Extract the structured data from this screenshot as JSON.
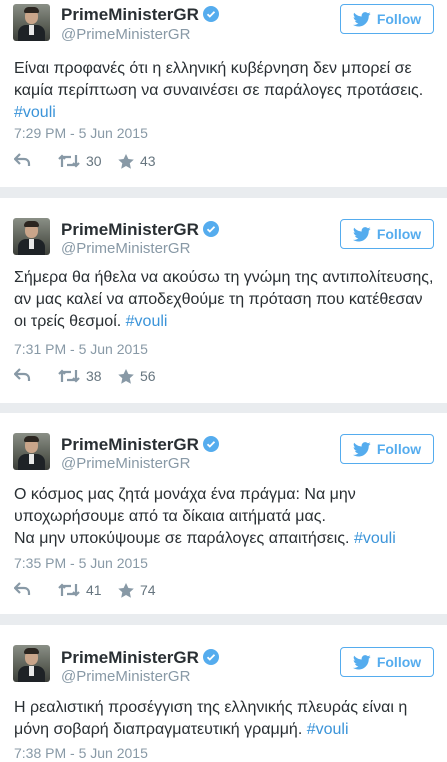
{
  "follow_label": "Follow",
  "colors": {
    "accent": "#55acee",
    "link": "#3b94d9",
    "muted": "#8899a6",
    "text": "#292f33"
  },
  "tweets": [
    {
      "name": "PrimeMinisterGR",
      "handle": "@PrimeMinisterGR",
      "text": "Είναι προφανές ότι η ελληνική κυβέρνηση δεν μπορεί σε καμία περίπτωση να συναινέσει σε παράλογες προτάσεις.",
      "hashtag": "#vouli",
      "time": "7:29 PM - 5 Jun 2015",
      "retweets": "30",
      "likes": "43"
    },
    {
      "name": "PrimeMinisterGR",
      "handle": "@PrimeMinisterGR",
      "text": "Σήμερα θα ήθελα να ακούσω τη γνώμη της αντιπολίτευσης, αν μας καλεί να αποδεχθούμε τη πρόταση που κατέθεσαν οι τρείς θεσμοί.",
      "hashtag": "#vouli",
      "time": "7:31 PM - 5 Jun 2015",
      "retweets": "38",
      "likes": "56"
    },
    {
      "name": "PrimeMinisterGR",
      "handle": "@PrimeMinisterGR",
      "text": "Ο κόσμος μας ζητά μονάχα ένα πράγμα: Να μην υποχωρήσουμε από τα δίκαια αιτήματά μας.\nΝα μην υποκύψουμε σε παράλογες απαιτήσεις.",
      "hashtag": "#vouli",
      "time": "7:35 PM - 5 Jun 2015",
      "retweets": "41",
      "likes": "74"
    },
    {
      "name": "PrimeMinisterGR",
      "handle": "@PrimeMinisterGR",
      "text": "Η ρεαλιστική προσέγγιση της ελληνικής πλευράς είναι η μόνη σοβαρή διαπραγματευτική γραμμή.",
      "hashtag": "#vouli",
      "time": "7:38 PM - 5 Jun 2015",
      "retweets": "",
      "likes": ""
    }
  ]
}
